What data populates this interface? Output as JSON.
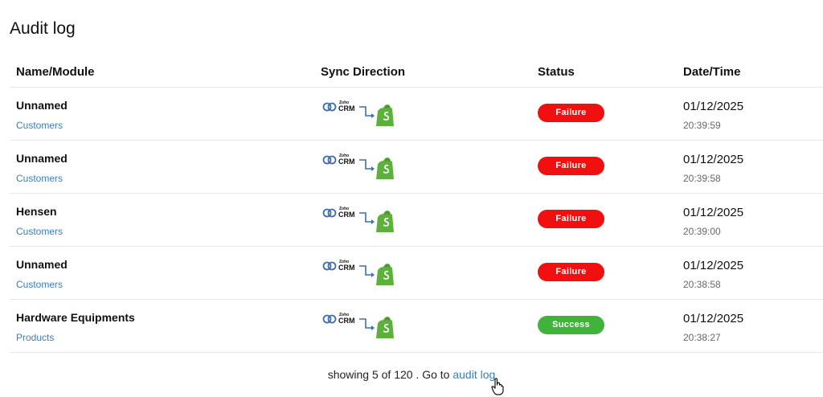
{
  "page": {
    "title": "Audit log"
  },
  "columns": {
    "name": "Name/Module",
    "sync": "Sync Direction",
    "status": "Status",
    "date": "Date/Time"
  },
  "sync_logo": {
    "brand_small": "Zoho",
    "brand_big": "CRM",
    "source_icon": "zoho-crm-icon",
    "target_icon": "shopify-icon"
  },
  "rows": [
    {
      "name": "Unnamed",
      "module": "Customers",
      "status": "Failure",
      "date": "01/12/2025",
      "time": "20:39:59"
    },
    {
      "name": "Unnamed",
      "module": "Customers",
      "status": "Failure",
      "date": "01/12/2025",
      "time": "20:39:58"
    },
    {
      "name": "Hensen",
      "module": "Customers",
      "status": "Failure",
      "date": "01/12/2025",
      "time": "20:39:00"
    },
    {
      "name": "Unnamed",
      "module": "Customers",
      "status": "Failure",
      "date": "01/12/2025",
      "time": "20:38:58"
    },
    {
      "name": "Hardware Equipments",
      "module": "Products",
      "status": "Success",
      "date": "01/12/2025",
      "time": "20:38:27"
    }
  ],
  "colors": {
    "failure": "#f20f0f",
    "success": "#3fb33a",
    "link": "#3a7fb5",
    "shopify": "#5eb03c"
  },
  "footer": {
    "showing_text": "showing 5 of 120 . Go to",
    "link_text": "audit log"
  }
}
